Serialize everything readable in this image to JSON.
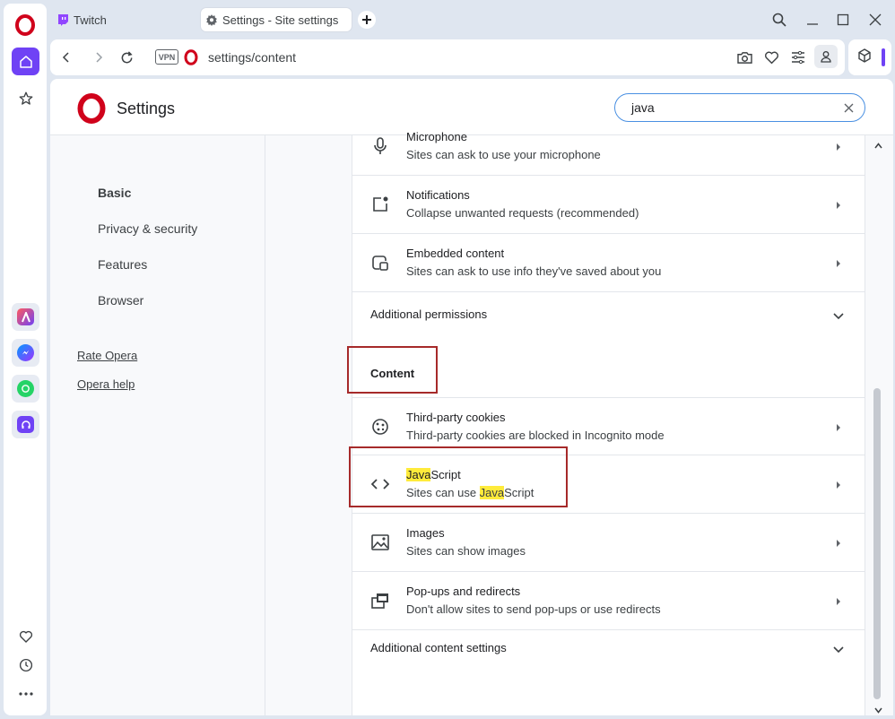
{
  "sidebar": {
    "icons": [
      "opera-logo",
      "home-icon",
      "star-icon",
      "aria-app",
      "messenger-app",
      "whatsapp-app",
      "music-app",
      "heart-icon",
      "history-icon",
      "more-icon"
    ]
  },
  "tabs": [
    {
      "label": "Twitch",
      "icon": "twitch-icon"
    },
    {
      "label": "Settings - Site settings",
      "icon": "gear-icon"
    }
  ],
  "addressbar": {
    "vpn_label": "VPN",
    "url": "settings/content"
  },
  "header": {
    "title": "Settings",
    "search_value": "java"
  },
  "leftnav": {
    "items": [
      "Basic",
      "Privacy & security",
      "Features",
      "Browser"
    ],
    "links": [
      "Rate Opera",
      "Opera help"
    ]
  },
  "content": {
    "rows_top": [
      {
        "title": "Microphone",
        "subtitle": "Sites can ask to use your microphone"
      },
      {
        "title": "Notifications",
        "subtitle": "Collapse unwanted requests (recommended)"
      },
      {
        "title": "Embedded content",
        "subtitle": "Sites can ask to use info they've saved about you"
      }
    ],
    "additional_permissions": "Additional permissions",
    "section_title": "Content",
    "rows_content": [
      {
        "title": "Third-party cookies",
        "subtitle": "Third-party cookies are blocked in Incognito mode"
      },
      {
        "title_hl": "Java",
        "title_rest": "Script",
        "subtitle_pre": "Sites can use ",
        "subtitle_hl": "Java",
        "subtitle_rest": "Script"
      },
      {
        "title": "Images",
        "subtitle": "Sites can show images"
      },
      {
        "title": "Pop-ups and redirects",
        "subtitle": "Don't allow sites to send pop-ups or use redirects"
      }
    ],
    "additional_content": "Additional content settings"
  },
  "colors": {
    "accent": "#6f42f5",
    "opera_red": "#d0021b",
    "highlight_box": "#a62a2a",
    "search_highlight": "#ffeb3b"
  }
}
